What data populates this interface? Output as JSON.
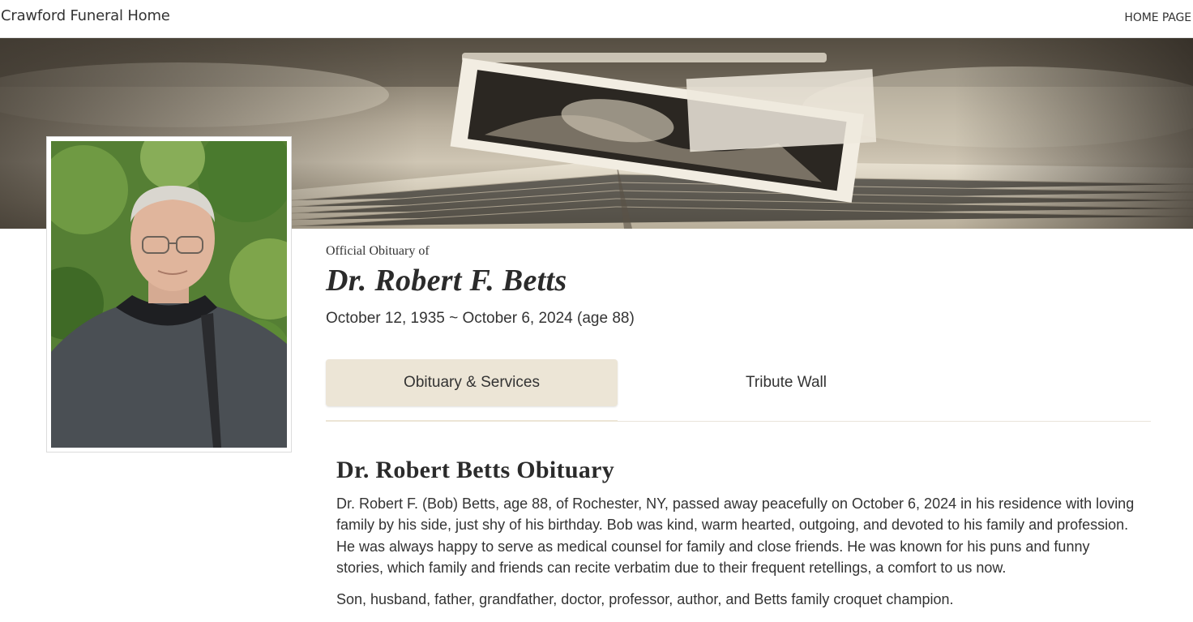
{
  "header": {
    "brand": "Crawford Funeral Home",
    "home_link": "HOME PAGE"
  },
  "hero": {
    "image_subject": "open book with old black-and-white photographs"
  },
  "portrait": {
    "subject": "elderly man with glasses in grey sweater, trees behind"
  },
  "obituary_header": {
    "kicker": "Official Obituary of",
    "name": "Dr. Robert F. Betts",
    "dates": "October 12, 1935 ~ October 6, 2024 (age 88)"
  },
  "tabs": [
    {
      "label": "Obituary & Services",
      "active": true
    },
    {
      "label": "Tribute Wall",
      "active": false
    }
  ],
  "obituary": {
    "title": "Dr. Robert Betts Obituary",
    "paragraphs": [
      "Dr. Robert F. (Bob) Betts, age 88, of Rochester, NY, passed away peacefully on October 6, 2024 in his residence with loving family by his side, just shy of his birthday. Bob was kind, warm hearted, outgoing, and devoted to his family and profession. He was always happy to serve as medical counsel for family and close friends. He was known for his puns and funny stories, which family and friends can recite verbatim due to their frequent retellings, a comfort to us now.",
      "Son, husband, father, grandfather, doctor, professor, author, and Betts family croquet champion."
    ]
  },
  "colors": {
    "active_tab_bg": "#ece5d6",
    "text": "#333333",
    "divider": "#e9e4da"
  }
}
